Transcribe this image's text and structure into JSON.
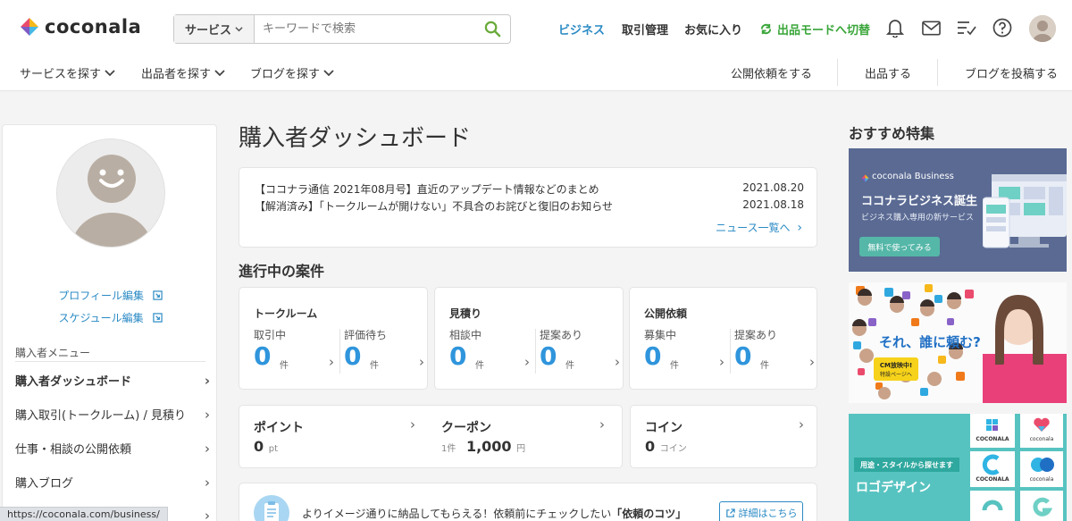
{
  "header": {
    "logo_text": "coconala",
    "search_category": "サービス",
    "search_placeholder": "キーワードで検索",
    "nav": {
      "business": "ビジネス",
      "transactions": "取引管理",
      "favorites": "お気に入り",
      "switch_mode": "出品モードへ切替"
    },
    "icons": [
      "bell-icon",
      "mail-icon",
      "checklist-icon",
      "help-icon"
    ],
    "subnav_left": [
      "サービスを探す",
      "出品者を探す",
      "ブログを探す"
    ],
    "subnav_right": [
      "公開依頼をする",
      "出品する",
      "ブログを投稿する"
    ]
  },
  "sidebar": {
    "profile_edit": "プロフィール編集",
    "schedule_edit": "スケジュール編集",
    "menu_heading": "購入者メニュー",
    "items": [
      {
        "label": "購入者ダッシュボード",
        "active": true
      },
      {
        "label": "購入取引(トークルーム) / 見積り",
        "active": false
      },
      {
        "label": "仕事・相談の公開依頼",
        "active": false
      },
      {
        "label": "購入ブログ",
        "active": false
      }
    ]
  },
  "main": {
    "title": "購入者ダッシュボード",
    "news": [
      {
        "text": "【ココナラ通信 2021年08月号】直近のアップデート情報などのまとめ",
        "date": "2021.08.20"
      },
      {
        "text": "【解消済み】「トークルームが開けない」不具合のお詫びと復旧のお知らせ",
        "date": "2021.08.18"
      }
    ],
    "news_more": "ニュース一覧へ",
    "progress_title": "進行中の案件",
    "progress_cards": [
      {
        "title": "トークルーム",
        "cols": [
          {
            "label": "取引中",
            "value": "0",
            "unit": "件"
          },
          {
            "label": "評価待ち",
            "value": "0",
            "unit": "件"
          }
        ]
      },
      {
        "title": "見積り",
        "cols": [
          {
            "label": "相談中",
            "value": "0",
            "unit": "件"
          },
          {
            "label": "提案あり",
            "value": "0",
            "unit": "件"
          }
        ]
      },
      {
        "title": "公開依頼",
        "cols": [
          {
            "label": "募集中",
            "value": "0",
            "unit": "件"
          },
          {
            "label": "提案あり",
            "value": "0",
            "unit": "件"
          }
        ]
      }
    ],
    "points": {
      "title": "ポイント",
      "value": "0",
      "unit": "pt"
    },
    "coupon": {
      "title": "クーポン",
      "count": "1件",
      "value": "1,000",
      "unit": "円"
    },
    "coin": {
      "title": "コイン",
      "value": "0",
      "unit": "コイン"
    },
    "tips": {
      "text_pre": "よりイメージ通りに納品してもらえる！依頼前にチェックしたい",
      "text_bold": "「依頼のコツ」",
      "button": "詳細はこちら"
    }
  },
  "recommend": {
    "title": "おすすめ特集",
    "banner1": {
      "brand": "coconala Business",
      "title": "ココナラビジネス誕生",
      "subtitle": "ビジネス購入専用の新サービス",
      "cta": "無料で使ってみる"
    },
    "banner2": {
      "title": "それ、誰に頼む?",
      "badge_1": "CM放映中!",
      "badge_2": "特設ページへ"
    },
    "banner3": {
      "tag": "用途・スタイルから探せます",
      "title": "ロゴデザイン",
      "logo_text": "COCONALA",
      "logo_text_small": "coconala"
    }
  },
  "status_url": "https://coconala.com/business/",
  "colors": {
    "link": "#2a8ac4",
    "accent_green": "#3aa63a",
    "number_blue": "#2f95dc",
    "search_icon": "#6aaa3a"
  }
}
